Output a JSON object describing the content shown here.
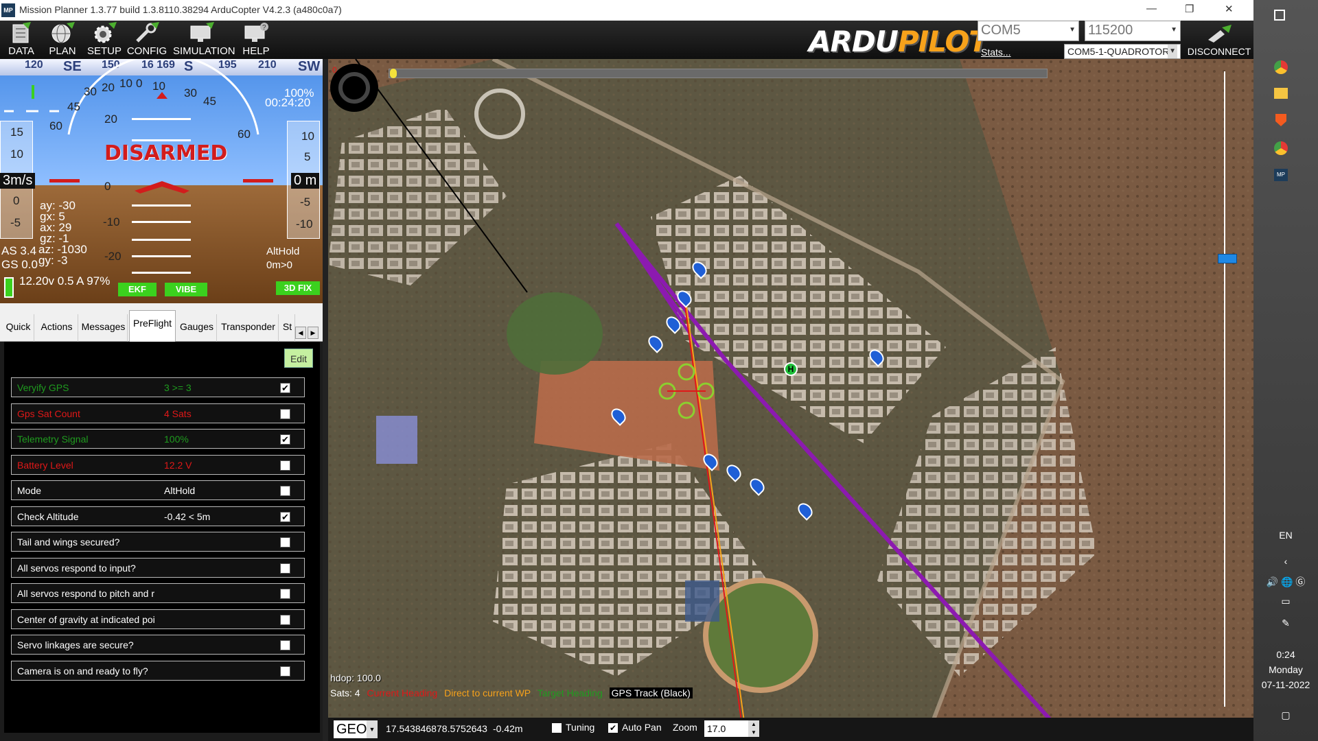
{
  "window": {
    "title": "Mission Planner 1.3.77 build 1.3.8110.38294 ArduCopter V4.2.3 (a480c0a7)",
    "logo": "MP"
  },
  "menu": [
    {
      "label": "DATA",
      "icon": "data-icon"
    },
    {
      "label": "PLAN",
      "icon": "plan-globe-icon"
    },
    {
      "label": "SETUP",
      "icon": "setup-gear-icon"
    },
    {
      "label": "CONFIG",
      "icon": "config-wrench-icon"
    },
    {
      "label": "SIMULATION",
      "icon": "simulation-monitor-icon"
    },
    {
      "label": "HELP",
      "icon": "help-monitor-icon"
    }
  ],
  "brand": {
    "logo_a": "ARDU",
    "logo_b": "PILOT"
  },
  "connection": {
    "port": "COM5",
    "baud": "115200",
    "stats": "Stats...",
    "vehicle": "COM5-1-QUADROTOR",
    "disconnect": "DISCONNECT"
  },
  "hud": {
    "compass": [
      "120",
      "SE",
      "150",
      "16 169",
      "S",
      "195",
      "210",
      "SW"
    ],
    "status": "DISARMED",
    "battery_pct_corner": "100%",
    "flight_time": "00:24:20",
    "speed_unit": "3m/s",
    "alt_box": "0 m",
    "ax": "ay: -30",
    "gx": "gx: 5",
    "axv": "ax: 29",
    "gz": "gz: -1",
    "az": "az: -1030",
    "gy": "gy: -3",
    "as": "AS 3.4",
    "gs": "GS 0.0",
    "battery": "12.20v 0.5 A 97%",
    "mode": "AltHold",
    "dist": "0m>0",
    "ekf": "EKF",
    "vibe": "VIBE",
    "gps": "3D FIX",
    "pitch_labels": [
      "20",
      "10",
      "0",
      "-10",
      "-20"
    ],
    "roll_labels": [
      "60",
      "45",
      "30",
      "20",
      "10",
      "0",
      "10",
      "20",
      "30",
      "45",
      "60"
    ],
    "left_tape": [
      "15",
      "10",
      "0",
      "-5"
    ],
    "right_tape": [
      "10",
      "5",
      "-5",
      "-10"
    ]
  },
  "tabs": [
    "Quick",
    "Actions",
    "Messages",
    "PreFlight",
    "Gauges",
    "Transponder",
    "St"
  ],
  "preflight": {
    "edit": "Edit",
    "rows": [
      {
        "label": "Veryify GPS",
        "value": "3 >= 3",
        "checked": true,
        "color": "#1f9c1f"
      },
      {
        "label": "Gps Sat Count",
        "value": "4 Sats",
        "checked": false,
        "color": "#e01818"
      },
      {
        "label": "Telemetry Signal",
        "value": "100%",
        "checked": true,
        "color": "#1f9c1f"
      },
      {
        "label": "Battery Level",
        "value": "12.2 V",
        "checked": false,
        "color": "#e01818"
      },
      {
        "label": "Mode",
        "value": "AltHold",
        "checked": false,
        "color": "#ffffff"
      },
      {
        "label": "Check Altitude",
        "value": "-0.42 < 5m",
        "checked": true,
        "color": "#ffffff"
      },
      {
        "label": "Tail and wings secured?",
        "value": "",
        "checked": false,
        "color": "#ffffff"
      },
      {
        "label": "All servos respond to input?",
        "value": "",
        "checked": false,
        "color": "#ffffff"
      },
      {
        "label": "All servos respond to pitch and r",
        "value": "",
        "checked": false,
        "color": "#ffffff"
      },
      {
        "label": "Center of gravity at indicated poi",
        "value": "",
        "checked": false,
        "color": "#ffffff"
      },
      {
        "label": "Servo linkages are secure?",
        "value": "",
        "checked": false,
        "color": "#ffffff"
      },
      {
        "label": "Camera is on and ready to fly?",
        "value": "",
        "checked": false,
        "color": "#ffffff"
      }
    ]
  },
  "map": {
    "hdop": "hdop: 100.0",
    "sats": "Sats: 4",
    "legend": [
      {
        "label": "Current Heading",
        "color": "#e01818"
      },
      {
        "label": "Direct to current WP",
        "color": "#f7a21b"
      },
      {
        "label": "Target Heading",
        "color": "#1f9c1f"
      },
      {
        "label": "GPS Track (Black)",
        "color": "#ffffff"
      }
    ],
    "home_label": "H",
    "coord_mode": "GEO",
    "lat": "17.5438468",
    "lon": "78.5752643",
    "alt": "-0.42m",
    "tuning": "Tuning",
    "autopan": "Auto Pan",
    "zoom_label": "Zoom",
    "zoom": "17.0",
    "tuning_checked": false,
    "autopan_checked": true
  },
  "taskbar": {
    "lang": "EN",
    "time": "0:24",
    "day": "Monday",
    "date": "07-11-2022"
  }
}
